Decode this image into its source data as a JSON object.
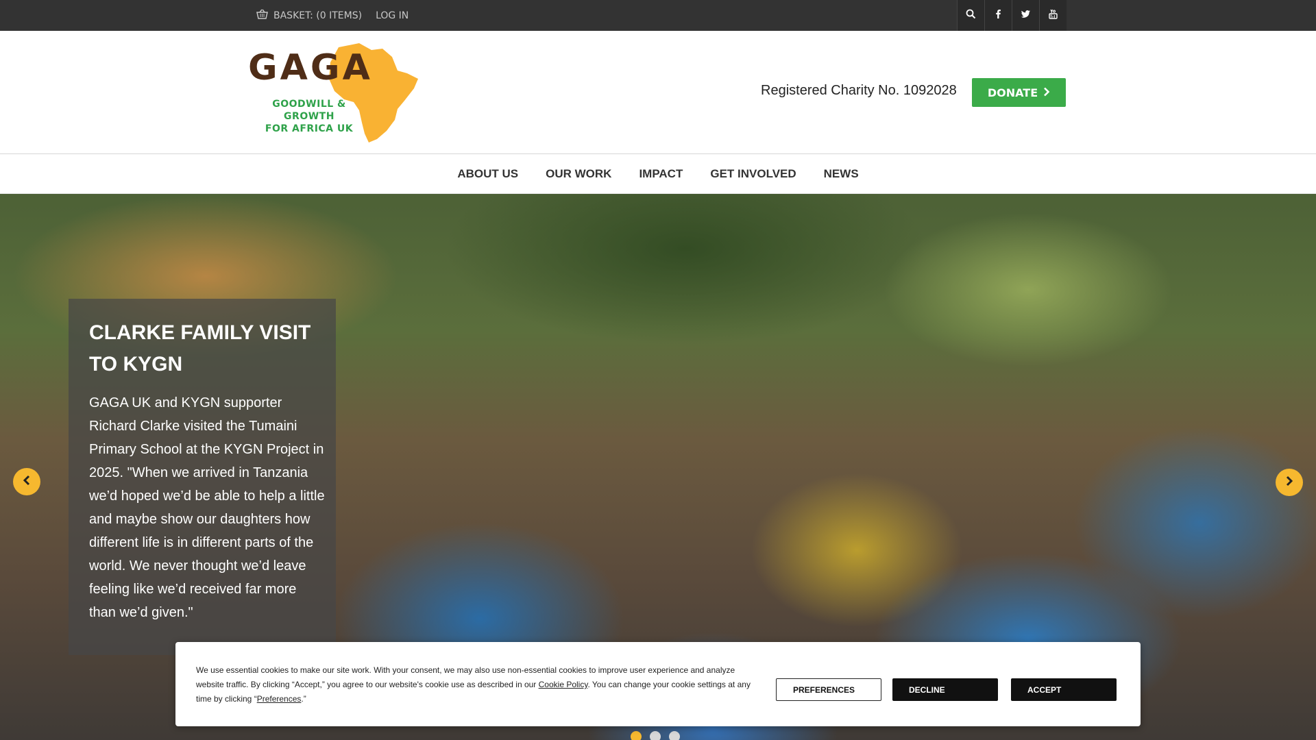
{
  "topbar": {
    "basket_label": "BASKET: (0 ITEMS)",
    "login_label": "LOG IN",
    "icons": [
      "search-icon",
      "facebook-icon",
      "twitter-icon",
      "youtube-icon"
    ]
  },
  "header": {
    "logo_word": "GAGA",
    "logo_sub_line1": "GOODWILL & GROWTH",
    "logo_sub_line2": "FOR AFRICA UK",
    "charity_text": "Registered Charity No. 1092028",
    "donate_label": "DONATE"
  },
  "nav": {
    "items": [
      "ABOUT US",
      "OUR WORK",
      "IMPACT",
      "GET INVOLVED",
      "NEWS"
    ]
  },
  "hero": {
    "title": "CLARKE FAMILY VISIT TO KYGN",
    "body": "GAGA UK and KYGN supporter Richard Clarke visited the Tumaini Primary School at the KYGN Project in 2025. \"When we arrived in Tanzania we’d hoped we’d be able to help a little and maybe show our daughters how different life is in different parts of the world. We never thought we’d leave feeling like we’d received far more than we’d given.\"",
    "slides_count": 3,
    "active_slide": 1
  },
  "cookie": {
    "text_part1": "We use essential cookies to make our site work. With your consent, we may also use non-essential cookies to improve user experience and analyze website traffic. By clicking “Accept,” you agree to our website's cookie use as described in our ",
    "cookie_policy_link": "Cookie Policy",
    "text_part2": ". You can change your cookie settings at any time by clicking “",
    "preferences_link": "Preferences",
    "text_part3": ".”",
    "preferences_button": "PREFERENCES",
    "decline_button": "DECLINE",
    "accept_button": "ACCEPT"
  },
  "colors": {
    "topbar": "#333333",
    "donate_green": "#3bab49",
    "accent_yellow": "#f6b82f",
    "logo_brown": "#4f2d17",
    "logo_green": "#2fa24a",
    "africa_orange": "#f9b233"
  }
}
